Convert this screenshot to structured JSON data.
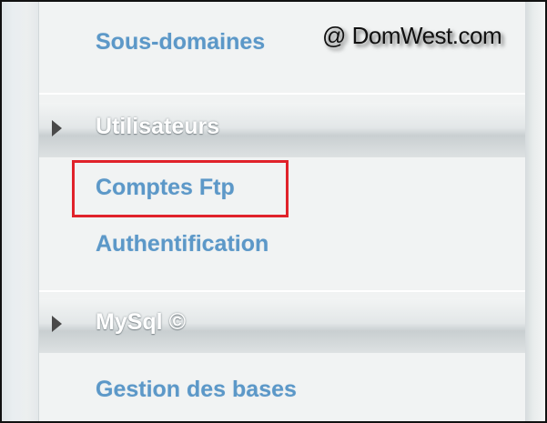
{
  "menu": {
    "items_top": {
      "subdomains_label": "Sous-domaines"
    },
    "sections": [
      {
        "title": "Utilisateurs",
        "items": [
          {
            "label": "Comptes Ftp"
          },
          {
            "label": "Authentification"
          }
        ]
      },
      {
        "title": "MySql ©",
        "items": [
          {
            "label": "Gestion des bases"
          }
        ]
      }
    ]
  },
  "watermark": {
    "text": "@ DomWest.com"
  },
  "colors": {
    "link": "#5c98c8",
    "header_text": "#ffffff",
    "highlight": "#e0222a",
    "arrow": "#4a4a4a"
  },
  "icons": {
    "section_expand": "triangle-right-icon"
  }
}
